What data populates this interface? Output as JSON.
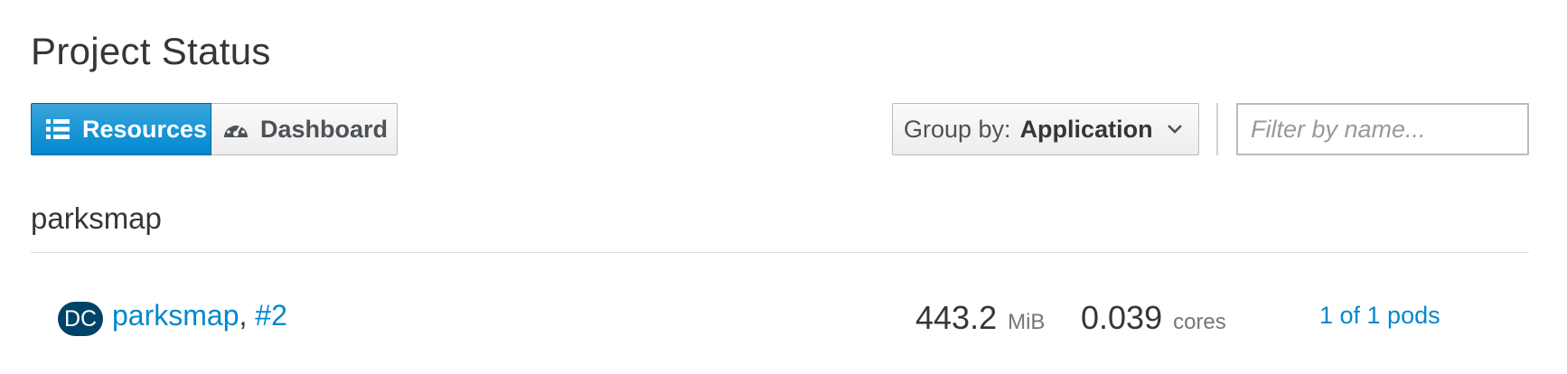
{
  "page": {
    "title": "Project Status"
  },
  "view_toggle": {
    "resources_label": "Resources",
    "resources_icon": "list-icon",
    "dashboard_label": "Dashboard",
    "dashboard_icon": "tachometer-icon",
    "active": "Resources"
  },
  "group_by": {
    "label": "Group by:",
    "value": "Application",
    "icon": "chevron-down-icon"
  },
  "filter": {
    "placeholder": "Filter by name..."
  },
  "application": {
    "name": "parksmap",
    "rows": [
      {
        "badge": "DC",
        "deployment_name": "parksmap",
        "separator": ",",
        "deployment_version": "#2",
        "memory_value": "443.2",
        "memory_unit": "MiB",
        "cpu_value": "0.039",
        "cpu_unit": "cores",
        "pods": "1 of 1 pods"
      }
    ]
  },
  "colors": {
    "accent": "#0088ce",
    "badge_bg": "#004368",
    "text": "#363636"
  }
}
